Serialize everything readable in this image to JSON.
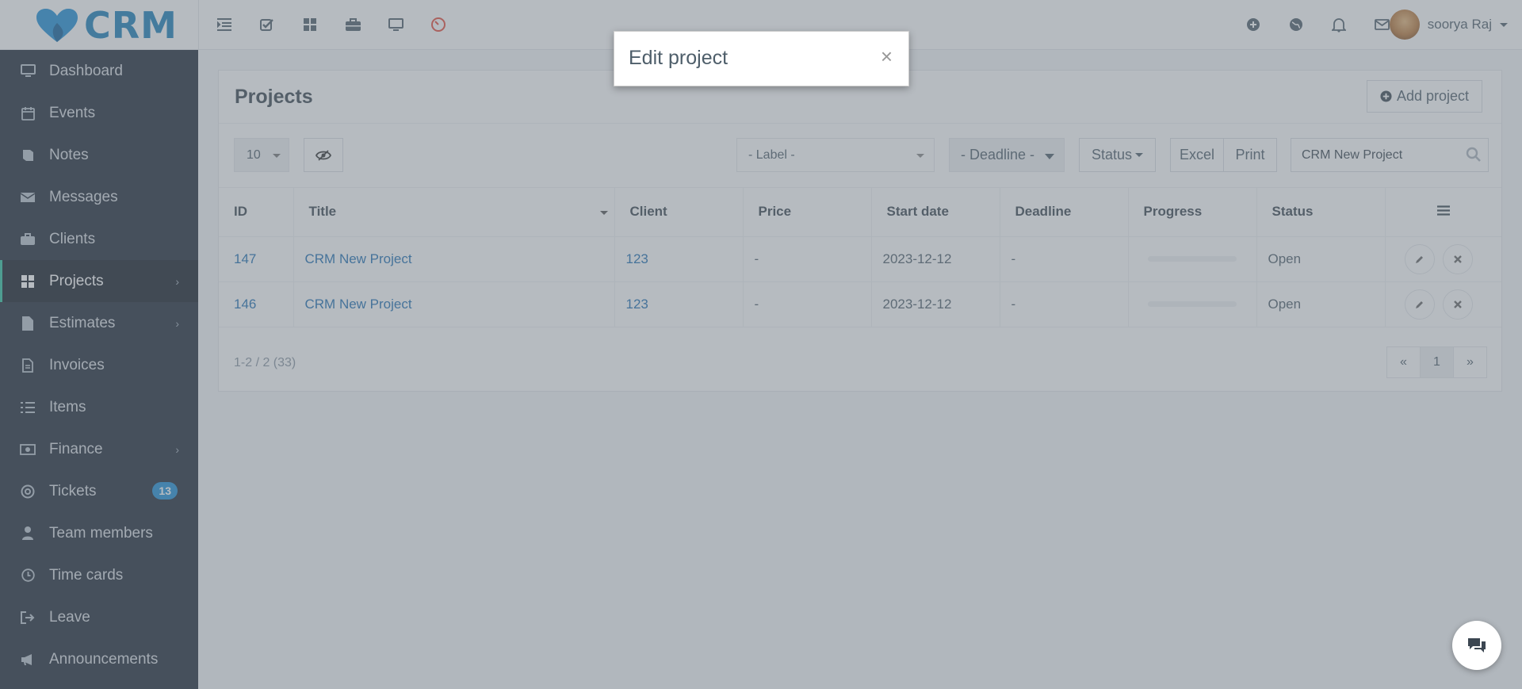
{
  "app": {
    "logo_text": "CRM"
  },
  "topbar": {
    "left_icons": [
      "list-indent-icon",
      "checkbox-icon",
      "grid-icon",
      "briefcase-icon",
      "desktop-icon",
      "timer-icon"
    ],
    "right_icons": [
      "plus-circle-icon",
      "globe-icon",
      "bell-icon",
      "envelope-icon"
    ],
    "user_name": "soorya Raj"
  },
  "sidebar": {
    "items": [
      {
        "label": "Dashboard",
        "icon": "desktop-icon"
      },
      {
        "label": "Events",
        "icon": "calendar-icon"
      },
      {
        "label": "Notes",
        "icon": "book-icon"
      },
      {
        "label": "Messages",
        "icon": "envelope-icon"
      },
      {
        "label": "Clients",
        "icon": "briefcase-icon"
      },
      {
        "label": "Projects",
        "icon": "grid-icon",
        "active": true,
        "chevron": true
      },
      {
        "label": "Estimates",
        "icon": "file-icon",
        "chevron": true
      },
      {
        "label": "Invoices",
        "icon": "file-text-icon"
      },
      {
        "label": "Items",
        "icon": "list-icon"
      },
      {
        "label": "Finance",
        "icon": "money-icon",
        "chevron": true
      },
      {
        "label": "Tickets",
        "icon": "life-ring-icon",
        "badge": "13"
      },
      {
        "label": "Team members",
        "icon": "user-icon"
      },
      {
        "label": "Time cards",
        "icon": "clock-icon"
      },
      {
        "label": "Leave",
        "icon": "sign-out-icon"
      },
      {
        "label": "Announcements",
        "icon": "bullhorn-icon"
      }
    ]
  },
  "projects": {
    "title": "Projects",
    "add_button": "Add project",
    "page_length": "10",
    "label_filter": "- Label -",
    "deadline_filter": "- Deadline -",
    "status_filter": "Status",
    "excel": "Excel",
    "print": "Print",
    "search_value": "CRM New Project",
    "columns": [
      "ID",
      "Title",
      "Client",
      "Price",
      "Start date",
      "Deadline",
      "Progress",
      "Status"
    ],
    "rows": [
      {
        "id": "147",
        "title": "CRM New Project",
        "client": "123",
        "price": "-",
        "start": "2023-12-12",
        "deadline": "-",
        "progress": 0,
        "status": "Open"
      },
      {
        "id": "146",
        "title": "CRM New Project",
        "client": "123",
        "price": "-",
        "start": "2023-12-12",
        "deadline": "-",
        "progress": 0,
        "status": "Open"
      }
    ],
    "summary": "1-2 / 2 (33)",
    "pager": {
      "prev": "«",
      "current": "1",
      "next": "»"
    }
  },
  "modal": {
    "title": "Edit project",
    "close": "×"
  },
  "colors": {
    "sidebar_bg": "#1f2936",
    "accent": "#2ec3a1",
    "link": "#1f6fb3",
    "badge": "#1f8fd6"
  }
}
